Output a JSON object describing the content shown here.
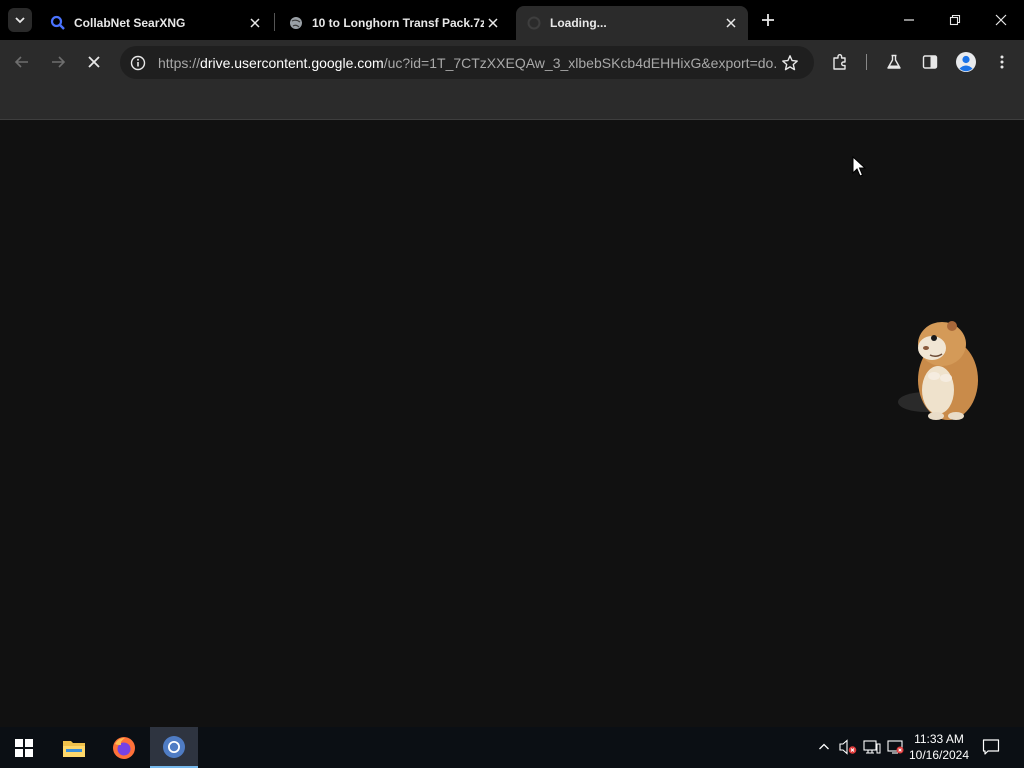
{
  "browser": {
    "tabs": [
      {
        "title": "CollabNet SearXNG",
        "active": false,
        "favicon": "search-icon"
      },
      {
        "title": "10 to Longhorn Transf Pack.7z",
        "active": false,
        "favicon": "globe-icon"
      },
      {
        "title": "Loading...",
        "active": true,
        "favicon": "loading-icon"
      }
    ],
    "url": {
      "scheme": "https://",
      "host": "drive.usercontent.google.com",
      "path": "/uc?id=1T_7CTzXXEQAw_3_xlbebSKcb4dEHHixG&export=do..."
    }
  },
  "colors": {
    "tabstrip": "#000000",
    "toolbar": "#2b2b2b",
    "content": "#111111",
    "taskbar": "#0b0f14",
    "accent": "#76b9ed"
  },
  "taskbar": {
    "apps": [
      "start-icon",
      "file-explorer-icon",
      "firefox-icon",
      "chrome-icon"
    ],
    "time": "11:33 AM",
    "date": "10/16/2024"
  }
}
